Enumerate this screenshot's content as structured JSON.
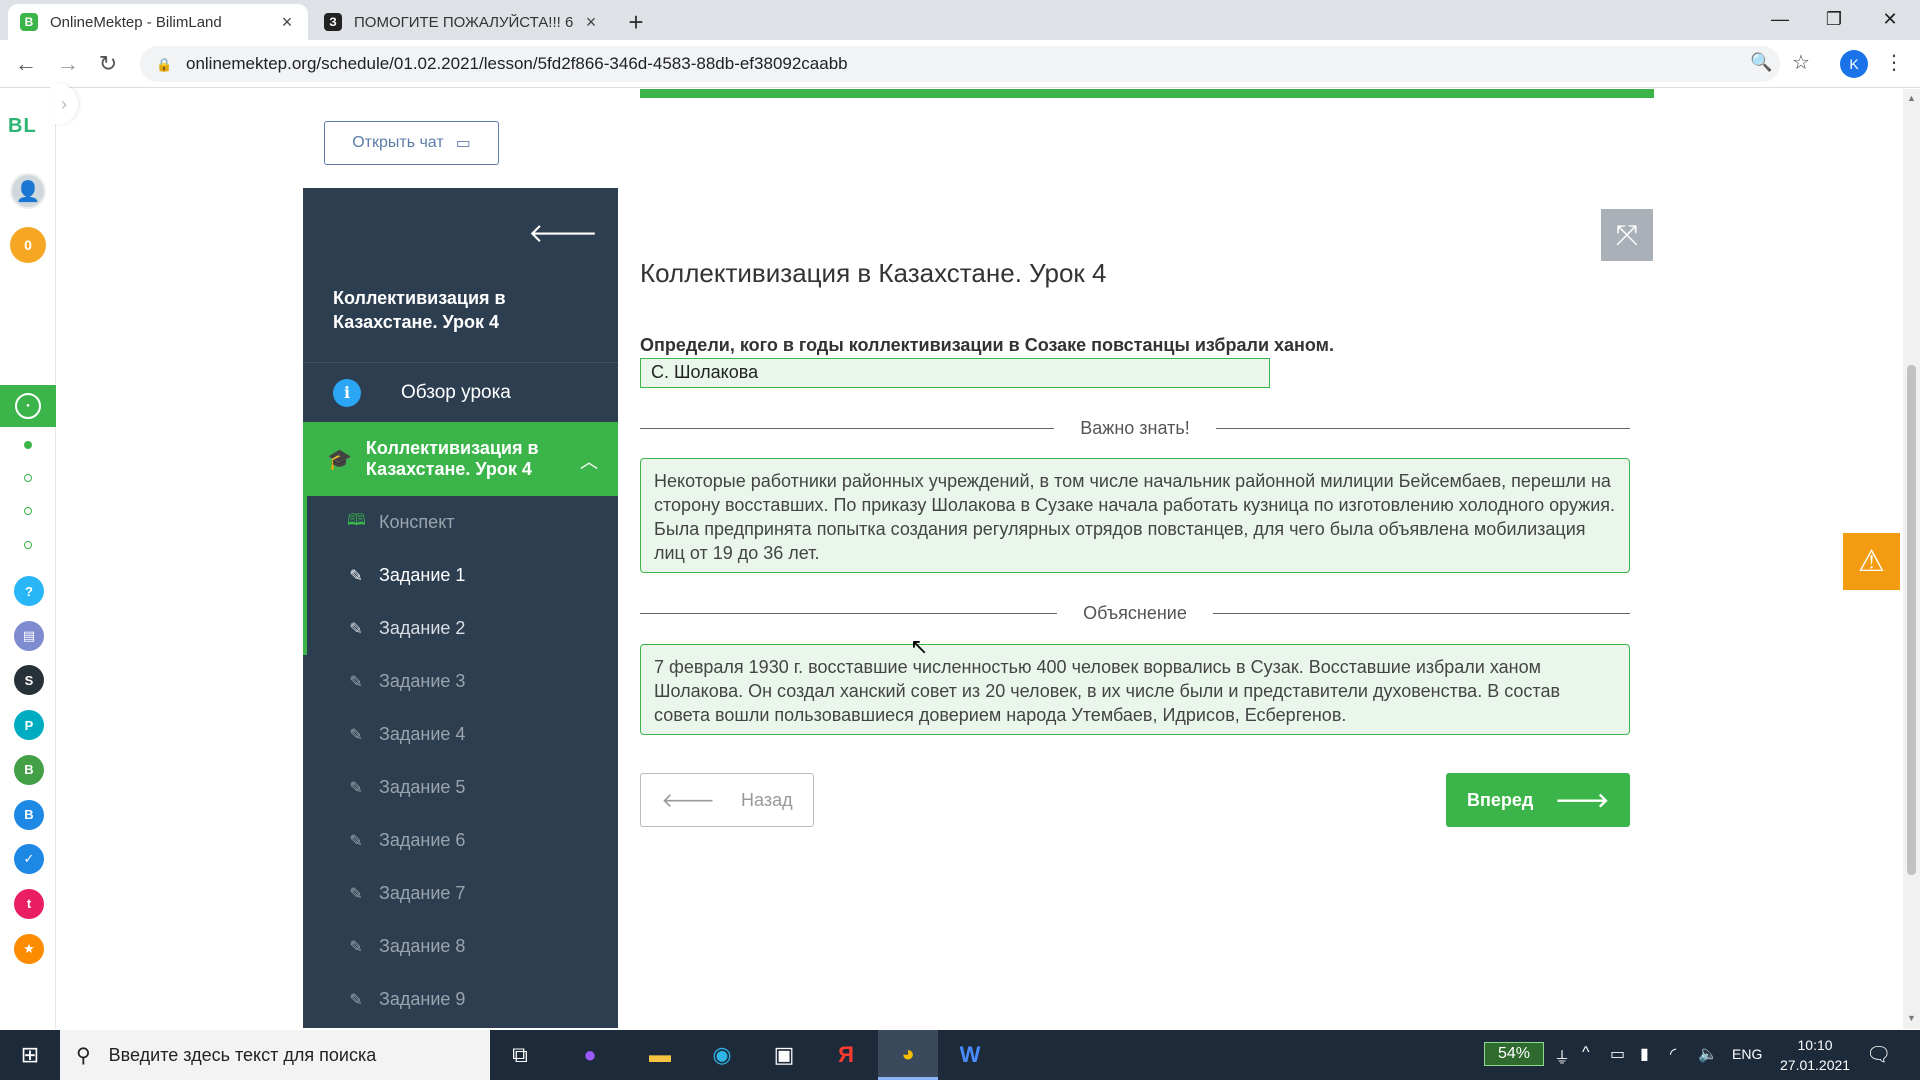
{
  "browser": {
    "tabs": [
      {
        "favicon": "B",
        "title": "OnlineMektep - BilimLand",
        "active": true
      },
      {
        "favicon": "З",
        "title": "ПОМОГИТЕ ПОЖАЛУЙСТА!!! 6",
        "active": false
      }
    ],
    "url": "onlinemektep.org/schedule/01.02.2021/lesson/5fd2f866-346d-4583-88db-ef38092caabb",
    "profile_initial": "K"
  },
  "appbar": {
    "logo": "BL",
    "points": "0",
    "icons": [
      {
        "name": "help-icon",
        "glyph": "?",
        "color": "#29b6f6"
      },
      {
        "name": "screen-icon",
        "glyph": "▤",
        "color": "#7e8ccf"
      },
      {
        "name": "smart-nation-icon",
        "glyph": "S",
        "color": "#263238"
      },
      {
        "name": "pisa-icon",
        "glyph": "P",
        "color": "#00acc1"
      },
      {
        "name": "bilimland-icon",
        "glyph": "B",
        "color": "#43a047"
      },
      {
        "name": "bilimbook-icon",
        "glyph": "B",
        "color": "#1e88e5"
      },
      {
        "name": "test-icon",
        "glyph": "✓",
        "color": "#1e88e5"
      },
      {
        "name": "twig-icon",
        "glyph": "t",
        "color": "#e91e63"
      },
      {
        "name": "orange-app-icon",
        "glyph": "★",
        "color": "#fb8c00"
      }
    ]
  },
  "chat_button": "Открыть чат",
  "sidebar": {
    "title": "Коллективизация в Казахстане. Урок 4",
    "overview": "Обзор урока",
    "current_lesson": "Коллективизация в Казахстане. Урок 4",
    "items": [
      {
        "label": "Конспект",
        "icon": "book",
        "state": "pending"
      },
      {
        "label": "Задание 1",
        "icon": "edit",
        "state": "current"
      },
      {
        "label": "Задание 2",
        "icon": "edit",
        "state": "done"
      },
      {
        "label": "Задание 3",
        "icon": "edit",
        "state": "pending"
      },
      {
        "label": "Задание 4",
        "icon": "edit",
        "state": "pending"
      },
      {
        "label": "Задание 5",
        "icon": "edit",
        "state": "pending"
      },
      {
        "label": "Задание 6",
        "icon": "edit",
        "state": "pending"
      },
      {
        "label": "Задание 7",
        "icon": "edit",
        "state": "pending"
      },
      {
        "label": "Задание 8",
        "icon": "edit",
        "state": "pending"
      },
      {
        "label": "Задание 9",
        "icon": "edit",
        "state": "pending"
      }
    ]
  },
  "main": {
    "heading": "Коллективизация в Казахстане. Урок 4",
    "question": "Определи, кого в годы коллективизации в Созаке повстанцы избрали ханом.",
    "answer": "С. Шолакова",
    "important_label": "Важно знать!",
    "important_text": "Некоторые работники районных учреждений, в том числе начальник районной милиции Бейсембаев, перешли на сторону восставших. По приказу Шолакова в Сузаке начала работать кузница по изготовлению холодного оружия. Была предпринята попытка создания регулярных отрядов повстанцев, для чего была объявлена мобилизация лиц от 19 до 36 лет.",
    "explanation_label": "Объяснение",
    "explanation_text": "7 февраля 1930 г. восставшие численностью 400 человек ворвались в Сузак. Восставшие избрали ханом Шолакова. Он создал ханский совет из 20 человек, в их числе были и представители духовенства. В состав совета вошли пользовавшиеся доверием народа Утембаев, Идрисов, Есбергенов.",
    "back_label": "Назад",
    "next_label": "Вперед"
  },
  "taskbar": {
    "search_placeholder": "Введите здесь текст для поиска",
    "battery": "54%",
    "lang": "ENG",
    "time": "10:10",
    "date": "27.01.2021"
  },
  "colors": {
    "accent": "#3bb54a",
    "sidebar_bg": "#2d3e50",
    "warning": "#f39c12"
  }
}
